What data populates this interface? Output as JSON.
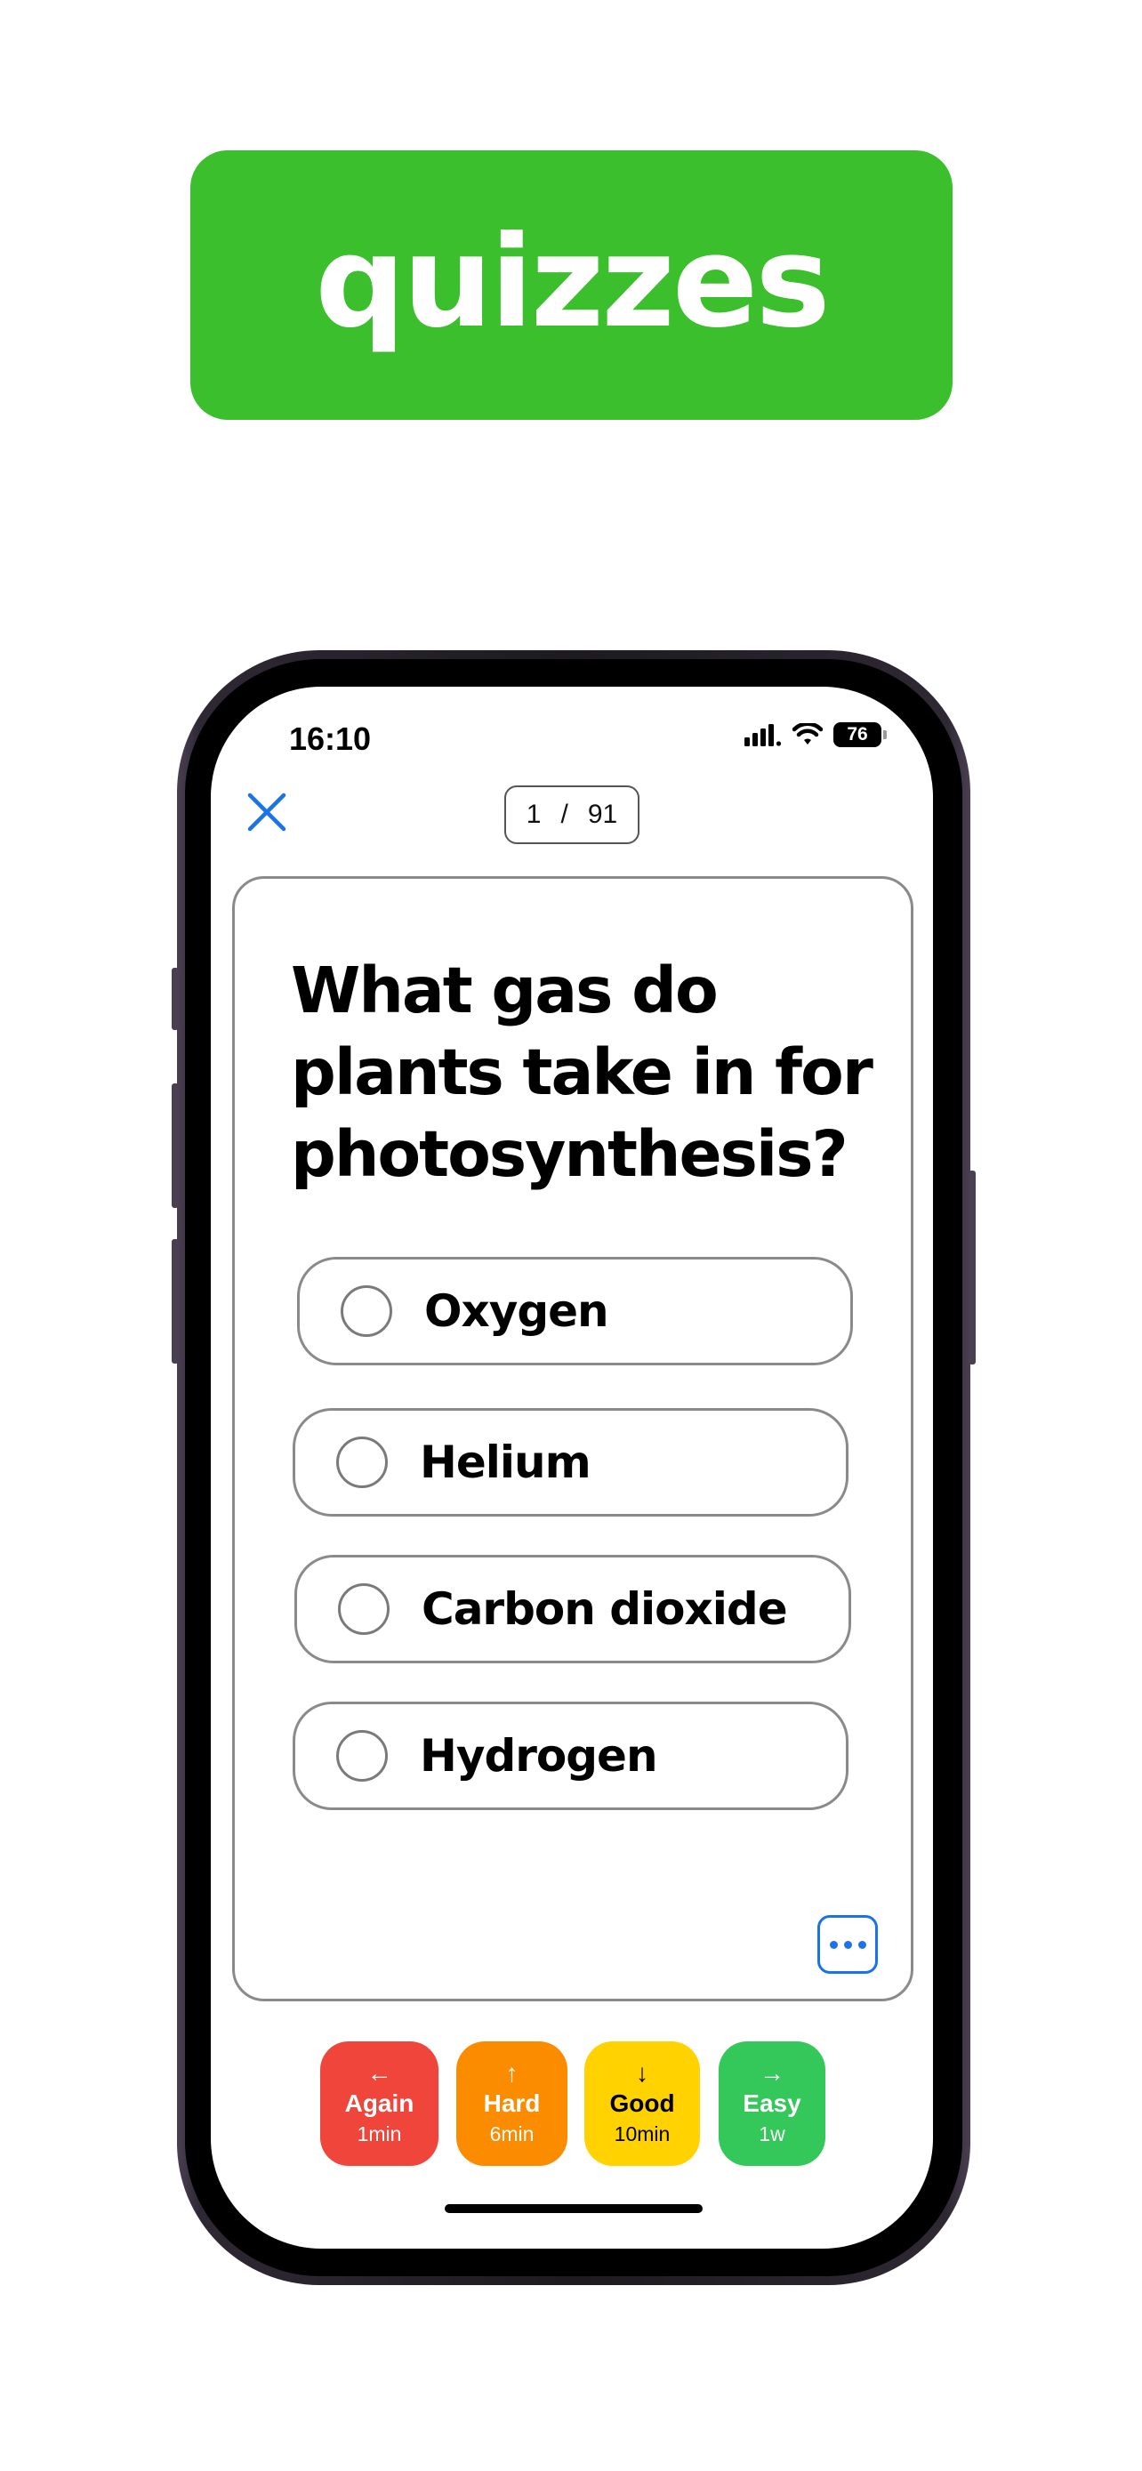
{
  "banner": {
    "text": "quizzes",
    "color": "#3bbf2d"
  },
  "status_bar": {
    "time": "16:10",
    "battery": "76"
  },
  "top_bar": {
    "current": "1",
    "separator": "/",
    "total": "91"
  },
  "question": "What gas do plants take in for photosynthesis?",
  "options": [
    {
      "label": "Oxygen"
    },
    {
      "label": "Helium"
    },
    {
      "label": "Carbon dioxide"
    },
    {
      "label": "Hydrogen"
    }
  ],
  "ratings": [
    {
      "arrow": "←",
      "label": "Again",
      "interval": "1min",
      "color": "#f0453a",
      "text_color": "#ffffff"
    },
    {
      "arrow": "↑",
      "label": "Hard",
      "interval": "6min",
      "color": "#fb8c00",
      "text_color": "#ffffff"
    },
    {
      "arrow": "↓",
      "label": "Good",
      "interval": "10min",
      "color": "#ffd200",
      "text_color": "#000000"
    },
    {
      "arrow": "→",
      "label": "Easy",
      "interval": "1w",
      "color": "#34c759",
      "text_color": "#ffffff"
    }
  ],
  "colors": {
    "accent": "#1a73e8",
    "card_border": "#8a8a8a"
  }
}
